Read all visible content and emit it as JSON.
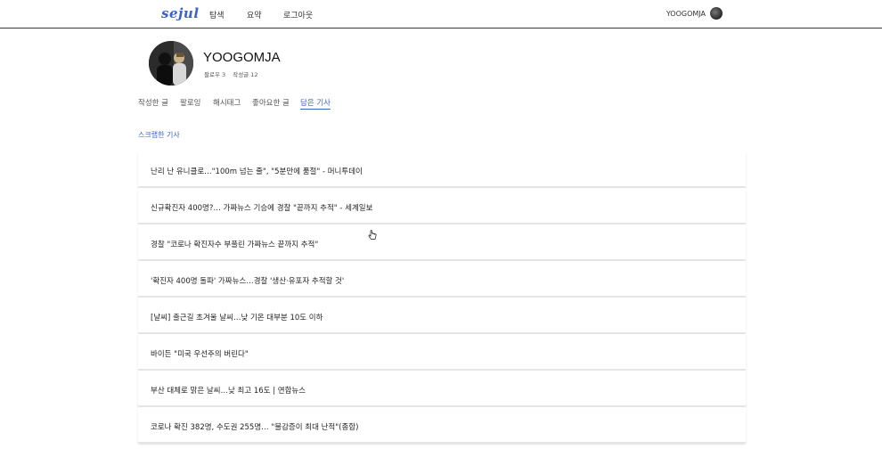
{
  "header": {
    "logo": "sejul",
    "nav": [
      "탐색",
      "요약",
      "로그아웃"
    ],
    "username": "YOOGOMJA"
  },
  "profile": {
    "name": "YOOGOMJA",
    "following": "팔로우 3",
    "posts": "작성글 12"
  },
  "tabs": [
    {
      "label": "작성한 글",
      "active": false
    },
    {
      "label": "팔로잉",
      "active": false
    },
    {
      "label": "해시태그",
      "active": false
    },
    {
      "label": "좋아요한 글",
      "active": false
    },
    {
      "label": "담은 기사",
      "active": true
    }
  ],
  "section_title": "스크랩한 기사",
  "articles": [
    "난리 난 유니클로…\"100m 넘는 줄\", \"5분만에 품절\" - 머니투데이",
    "신규확진자 400명?… 가짜뉴스 기승에 경찰 \"끝까지 추적\" - 세계일보",
    "경찰 \"코로나 확진자수 부풀린 가짜뉴스 끝까지 추적\"",
    "'확진자 400명 돌파' 가짜뉴스…경찰 '생산·유포자 추적할 것'",
    "[날씨] 출근길 초겨울 날씨…낮 기온 대부분 10도 이하",
    "바이든 \"미국 우선주의 버린다\"",
    "부산 대체로 맑은 날씨…낮 최고 16도 | 연합뉴스",
    "코로나 확진 382명, 수도권 255명… \"불감증이 최대 난적\"(종합)"
  ]
}
